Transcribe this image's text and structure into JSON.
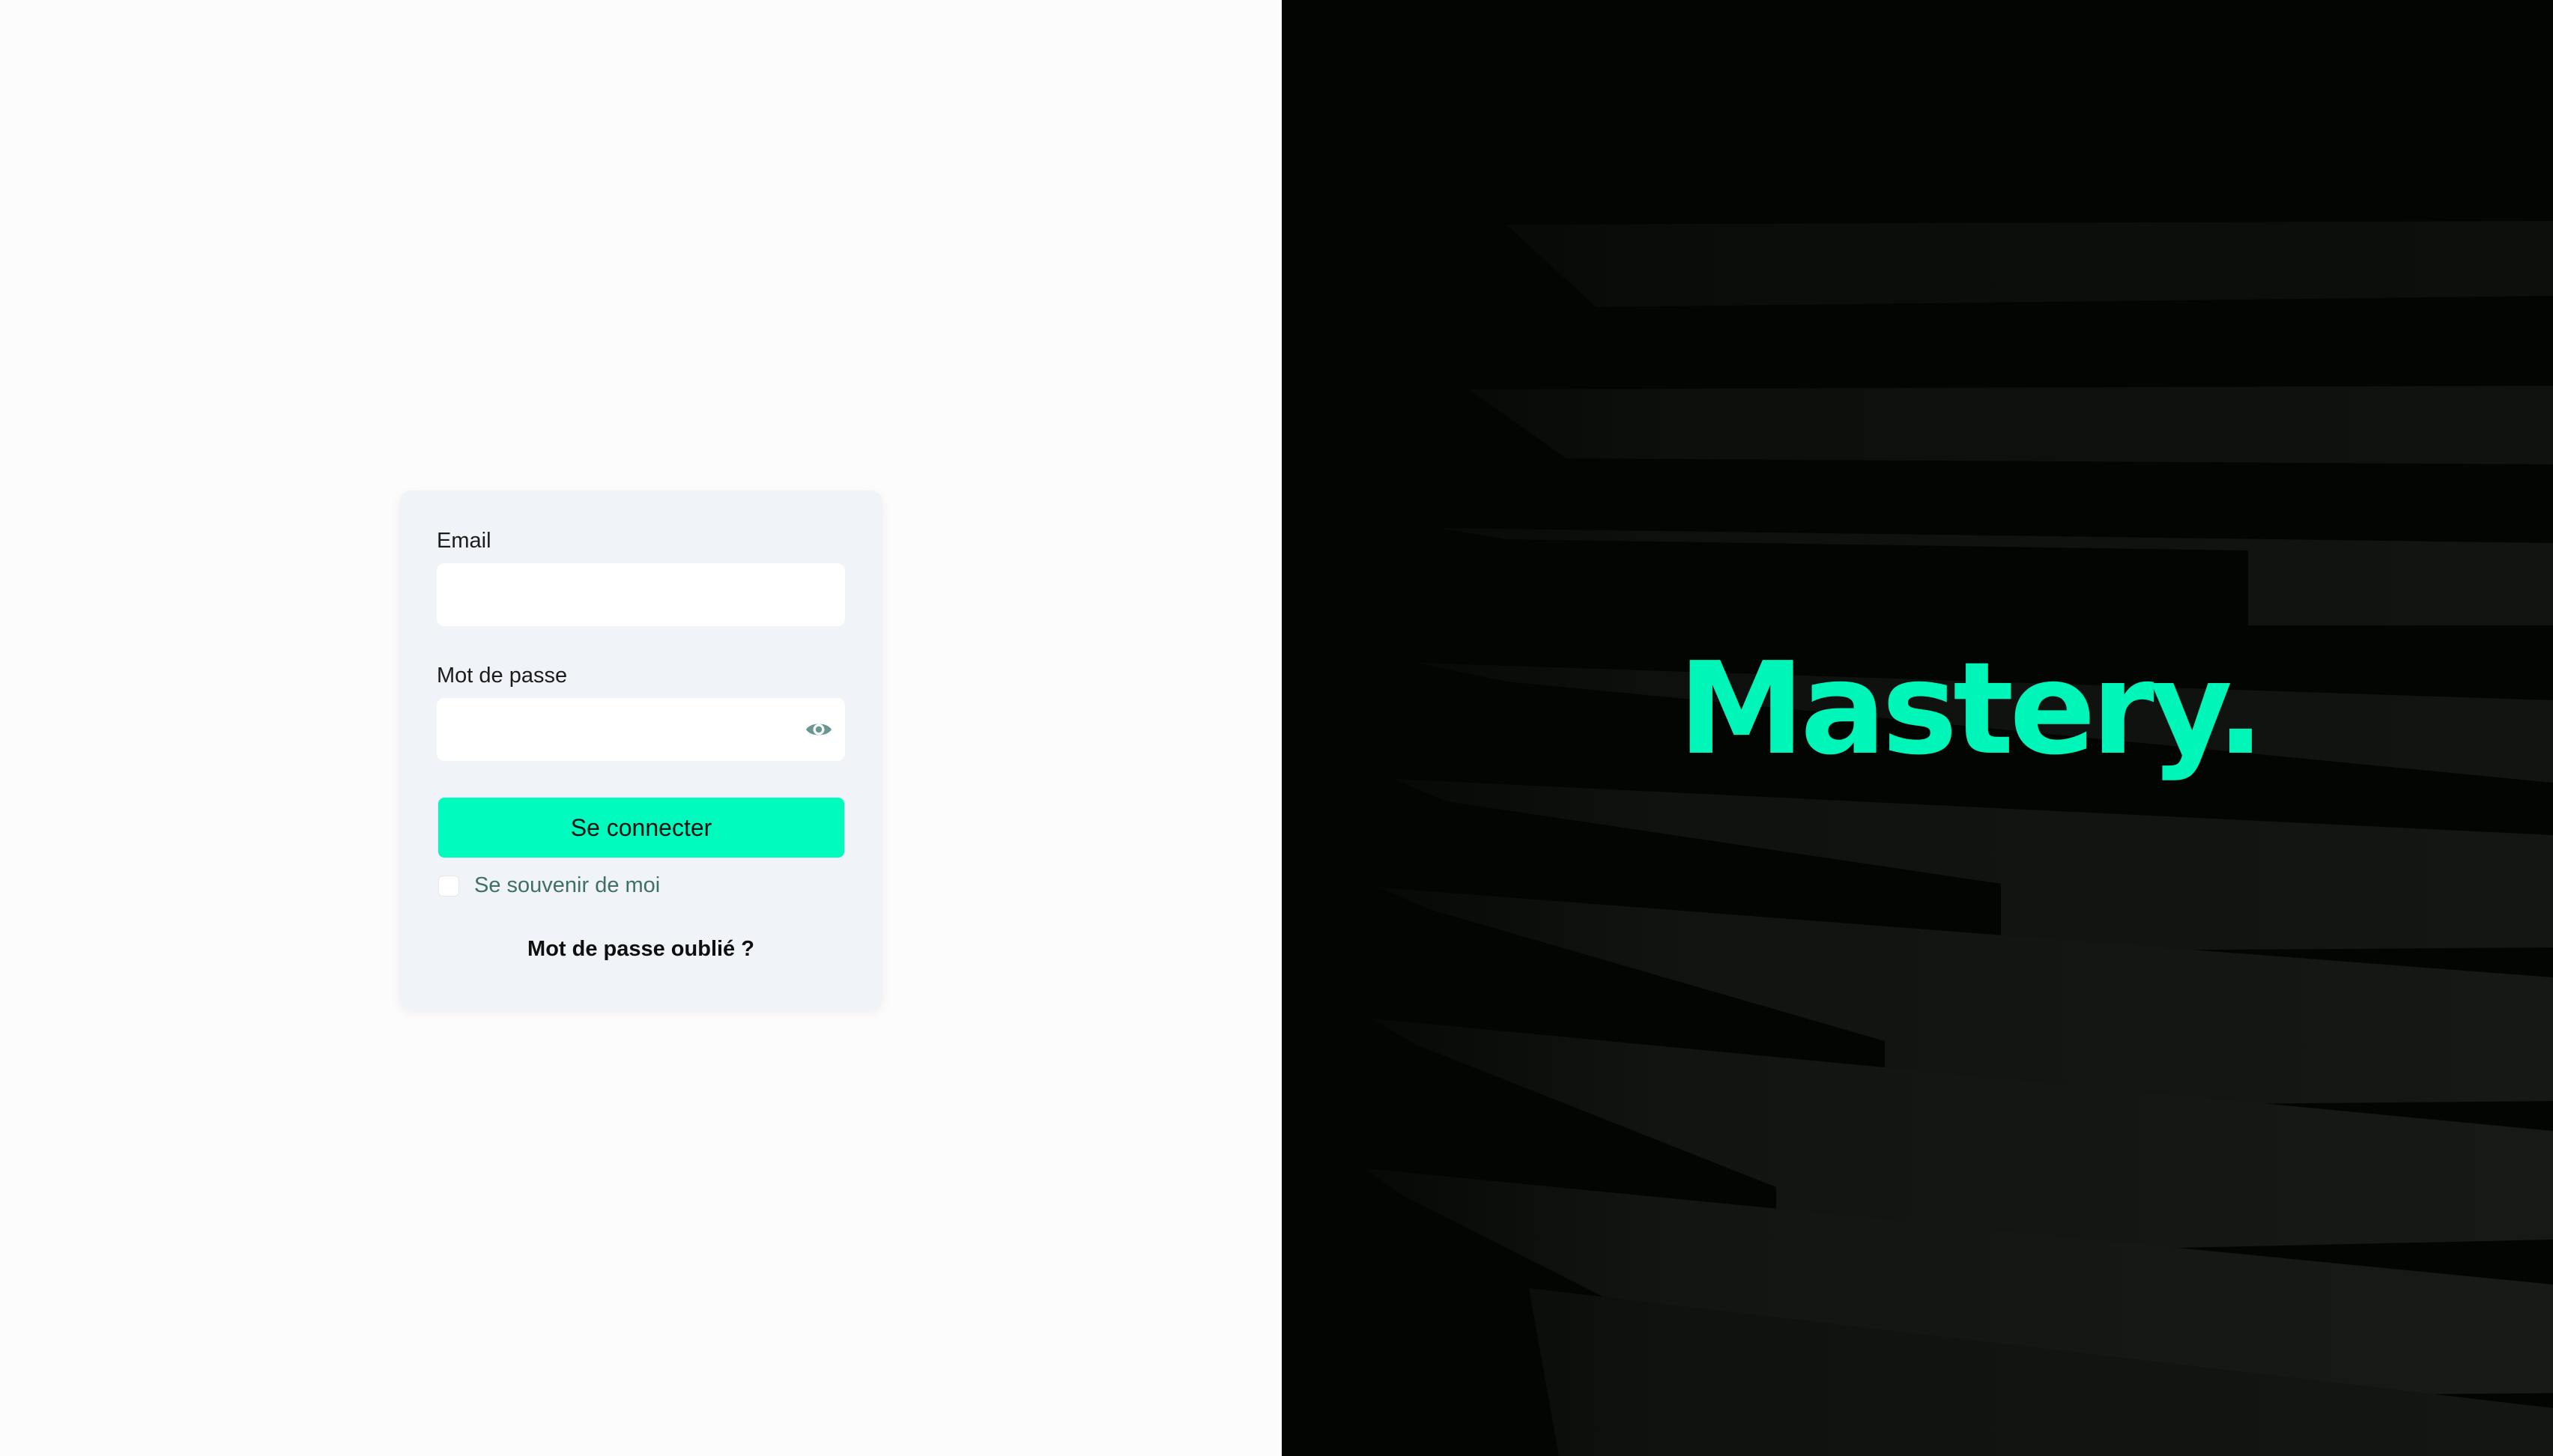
{
  "login": {
    "email_label": "Email",
    "email_value": "",
    "password_label": "Mot de passe",
    "password_value": "",
    "submit_label": "Se connecter",
    "remember_label": "Se souvenir de moi",
    "remember_checked": false,
    "forgot_label": "Mot de passe oublié ?",
    "password_toggle_icon": "eye-icon"
  },
  "brand": {
    "logo_text": "Mastery.",
    "accent_color": "#00f5b9",
    "button_color": "#00fbbf",
    "dark_background": "#030503"
  }
}
